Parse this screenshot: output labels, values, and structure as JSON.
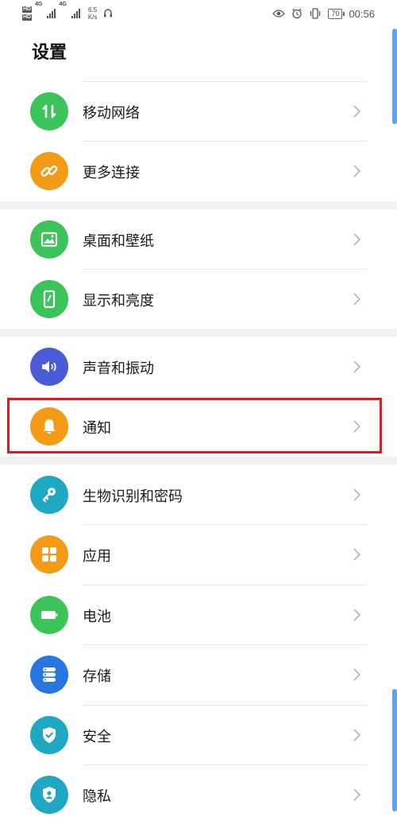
{
  "status_bar": {
    "hd_top": "HD",
    "hd_bottom": "HD",
    "net1": "4G",
    "net2": "4G",
    "speed_value": "6.5",
    "speed_unit": "K/s",
    "battery": "70",
    "time": "00:56"
  },
  "page": {
    "title": "设置"
  },
  "rows": [
    {
      "label": "移动网络",
      "icon": "mobile-data-icon",
      "color": "#3cc35a"
    },
    {
      "label": "更多连接",
      "icon": "link-icon",
      "color": "#f39a16"
    },
    {
      "label": "桌面和壁纸",
      "icon": "image-icon",
      "color": "#3cc35a"
    },
    {
      "label": "显示和亮度",
      "icon": "phone-display-icon",
      "color": "#3cc35a"
    },
    {
      "label": "声音和振动",
      "icon": "volume-icon",
      "color": "#4a5bd8"
    },
    {
      "label": "通知",
      "icon": "bell-icon",
      "color": "#f39a16"
    },
    {
      "label": "生物识别和密码",
      "icon": "key-icon",
      "color": "#1fa8c2"
    },
    {
      "label": "应用",
      "icon": "apps-grid-icon",
      "color": "#f39a16"
    },
    {
      "label": "电池",
      "icon": "battery-icon",
      "color": "#3cc35a"
    },
    {
      "label": "存储",
      "icon": "storage-icon",
      "color": "#2876e0"
    },
    {
      "label": "安全",
      "icon": "shield-check-icon",
      "color": "#1fa8c2"
    },
    {
      "label": "隐私",
      "icon": "privacy-shield-icon",
      "color": "#1fa8c2"
    }
  ],
  "highlight_color": "#e01b1b"
}
